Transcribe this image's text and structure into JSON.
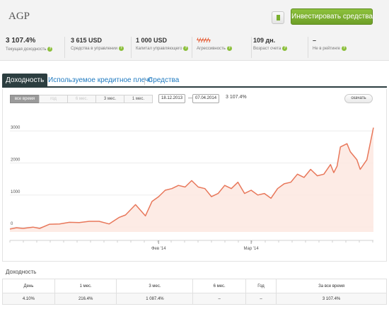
{
  "account": {
    "name": "AGP",
    "invest_label": "Инвестировать средства",
    "bookmark_icon": "bookmark-icon",
    "accent": "#7ab02e"
  },
  "stats": [
    {
      "value": "3 107.4%",
      "label": "Текущая доходность"
    },
    {
      "value": "3 615 USD",
      "label": "Средства в управлении"
    },
    {
      "value": "1 000 USD",
      "label": "Капитал управляющего"
    },
    {
      "value": "ϟϟϟϟϟ",
      "label": "Агрессивность"
    },
    {
      "value": "109 дн.",
      "label": "Возраст счета"
    },
    {
      "value": "–",
      "label": "Не в рейтинге"
    }
  ],
  "tabs": [
    {
      "label": "Доходность",
      "active": true
    },
    {
      "label": "Используемое кредитное плечо",
      "active": false
    },
    {
      "label": "Средства",
      "active": false
    }
  ],
  "chart_controls": {
    "periods": [
      {
        "label": "все время",
        "state": "active"
      },
      {
        "label": "год",
        "state": "disabled"
      },
      {
        "label": "6 мес.",
        "state": "disabled"
      },
      {
        "label": "3 мес.",
        "state": "normal"
      },
      {
        "label": "1 мес.",
        "state": "normal"
      }
    ],
    "date_from": "18.12.2013",
    "date_separator": "—",
    "date_to": "07.04.2014",
    "range_value": "3 107.4%",
    "download_label": "скачать"
  },
  "chart_data": {
    "type": "area",
    "title": "",
    "xlabel": "",
    "ylabel": "",
    "color": "#e8775a",
    "fill": "#fde9e2",
    "ylim": [
      -150,
      3200
    ],
    "yticks": [
      0,
      1000,
      2000,
      3000
    ],
    "xticks": [
      {
        "label": "Фев '14",
        "x": "2014-02-01"
      },
      {
        "label": "Мар '14",
        "x": "2014-03-01"
      }
    ],
    "grid": true,
    "series": [
      {
        "x": [
          "2013-12-18",
          "2013-12-20",
          "2013-12-22",
          "2013-12-25",
          "2013-12-27",
          "2013-12-30",
          "2014-01-02",
          "2014-01-05",
          "2014-01-08",
          "2014-01-11",
          "2014-01-14",
          "2014-01-17",
          "2014-01-20",
          "2014-01-22",
          "2014-01-25",
          "2014-01-28",
          "2014-01-30",
          "2014-02-01",
          "2014-02-03",
          "2014-02-05",
          "2014-02-07",
          "2014-02-09",
          "2014-02-11",
          "2014-02-13",
          "2014-02-15",
          "2014-02-17",
          "2014-02-19",
          "2014-02-21",
          "2014-02-23",
          "2014-02-25",
          "2014-02-27",
          "2014-03-01",
          "2014-03-03",
          "2014-03-05",
          "2014-03-07",
          "2014-03-09",
          "2014-03-11",
          "2014-03-13",
          "2014-03-15",
          "2014-03-17",
          "2014-03-19",
          "2014-03-21",
          "2014-03-23",
          "2014-03-25",
          "2014-03-26",
          "2014-03-27",
          "2014-03-28",
          "2014-03-30",
          "2014-03-31",
          "2014-04-02",
          "2014-04-03",
          "2014-04-05",
          "2014-04-07"
        ],
        "values": [
          -60,
          -20,
          -40,
          0,
          -40,
          90,
          100,
          150,
          140,
          180,
          180,
          100,
          300,
          380,
          700,
          350,
          800,
          950,
          1150,
          1200,
          1300,
          1250,
          1450,
          1250,
          1200,
          950,
          1050,
          1300,
          1200,
          1400,
          1050,
          1150,
          1000,
          1050,
          900,
          1200,
          1350,
          1400,
          1650,
          1550,
          1800,
          1600,
          1650,
          1950,
          1700,
          1900,
          2500,
          2600,
          2350,
          2100,
          1800,
          2100,
          3100
        ]
      }
    ]
  },
  "table": {
    "title": "Доходность",
    "headers": [
      "День",
      "1 мес.",
      "3 мес.",
      "6 мес.",
      "Год",
      "За все время"
    ],
    "values": [
      "4.10%",
      "216.4%",
      "1 087.4%",
      "–",
      "–",
      "3 107.4%"
    ]
  }
}
